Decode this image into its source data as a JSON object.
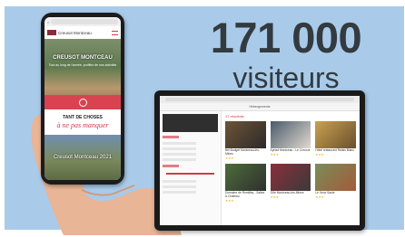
{
  "headline": {
    "number": "171 000",
    "word": "visiteurs"
  },
  "phone": {
    "site_name": "Creusot Montceau",
    "hero_title": "CREUSOT MONTCEAU",
    "hero_subtitle": "Tout au long de l'année, profitez de nos activités",
    "section_title_1": "TANT DE CHOSES",
    "section_title_2": "à ne pas manquer",
    "card_title": "Creusot Montceau 2021"
  },
  "tablet": {
    "header": "Hébergements",
    "results_title": "17 résultats",
    "listings": [
      {
        "name": "Bel Budget Montceau-les-Mines",
        "color1": "#6d5437",
        "color2": "#2d2a2a"
      },
      {
        "name": "Kyriad Montceau - Le Creusot",
        "color1": "#4a5b6b",
        "color2": "#e0d9cf"
      },
      {
        "name": "Hôtel restaurant Relais Blanc",
        "color1": "#c9a24f",
        "color2": "#6a4f2f"
      },
      {
        "name": "Domaine de Rumilley - Salles & Château",
        "color1": "#4d6d3a",
        "color2": "#2f2f2f"
      },
      {
        "name": "Gîte Montceau-les-Mines",
        "color1": "#8a2f3a",
        "color2": "#3a3a3a"
      },
      {
        "name": "Le Veux Saule",
        "color1": "#7a8d5a",
        "color2": "#a35a3a"
      }
    ]
  },
  "colors": {
    "panel": "#a9cbe9",
    "accent": "#d23a4a",
    "headline": "#333a40"
  }
}
